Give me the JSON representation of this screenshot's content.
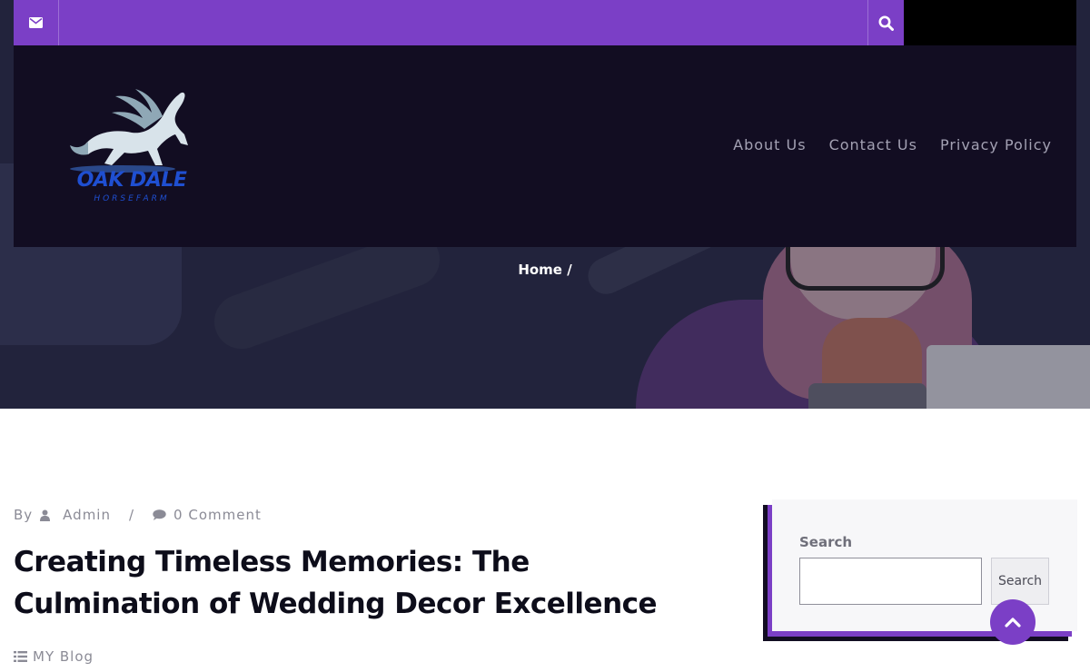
{
  "header": {
    "logo_text": "OAK DALE",
    "logo_subtext": "HORSEFARM",
    "nav": [
      {
        "label": "About Us"
      },
      {
        "label": "Contact Us"
      },
      {
        "label": "Privacy Policy"
      }
    ]
  },
  "hero": {
    "breadcrumb": "Home /"
  },
  "post": {
    "by_label": "By",
    "author": "Admin",
    "separator": "/",
    "comments": "0 Comment",
    "title": "Creating Timeless Memories: The Culmination of Wedding Decor Excellence",
    "category": "MY Blog"
  },
  "sidebar": {
    "search_label": "Search",
    "search_value": "",
    "search_button": "Search"
  },
  "icons": {
    "mail": "envelope-icon",
    "search": "search-icon",
    "author": "user-icon",
    "comments": "comment-icon",
    "category": "list-icon",
    "scroll_top": "chevron-up-icon"
  },
  "colors": {
    "accent": "#7b3fc6",
    "header_bg": "#120d22",
    "title_text": "#0d0d1a"
  }
}
